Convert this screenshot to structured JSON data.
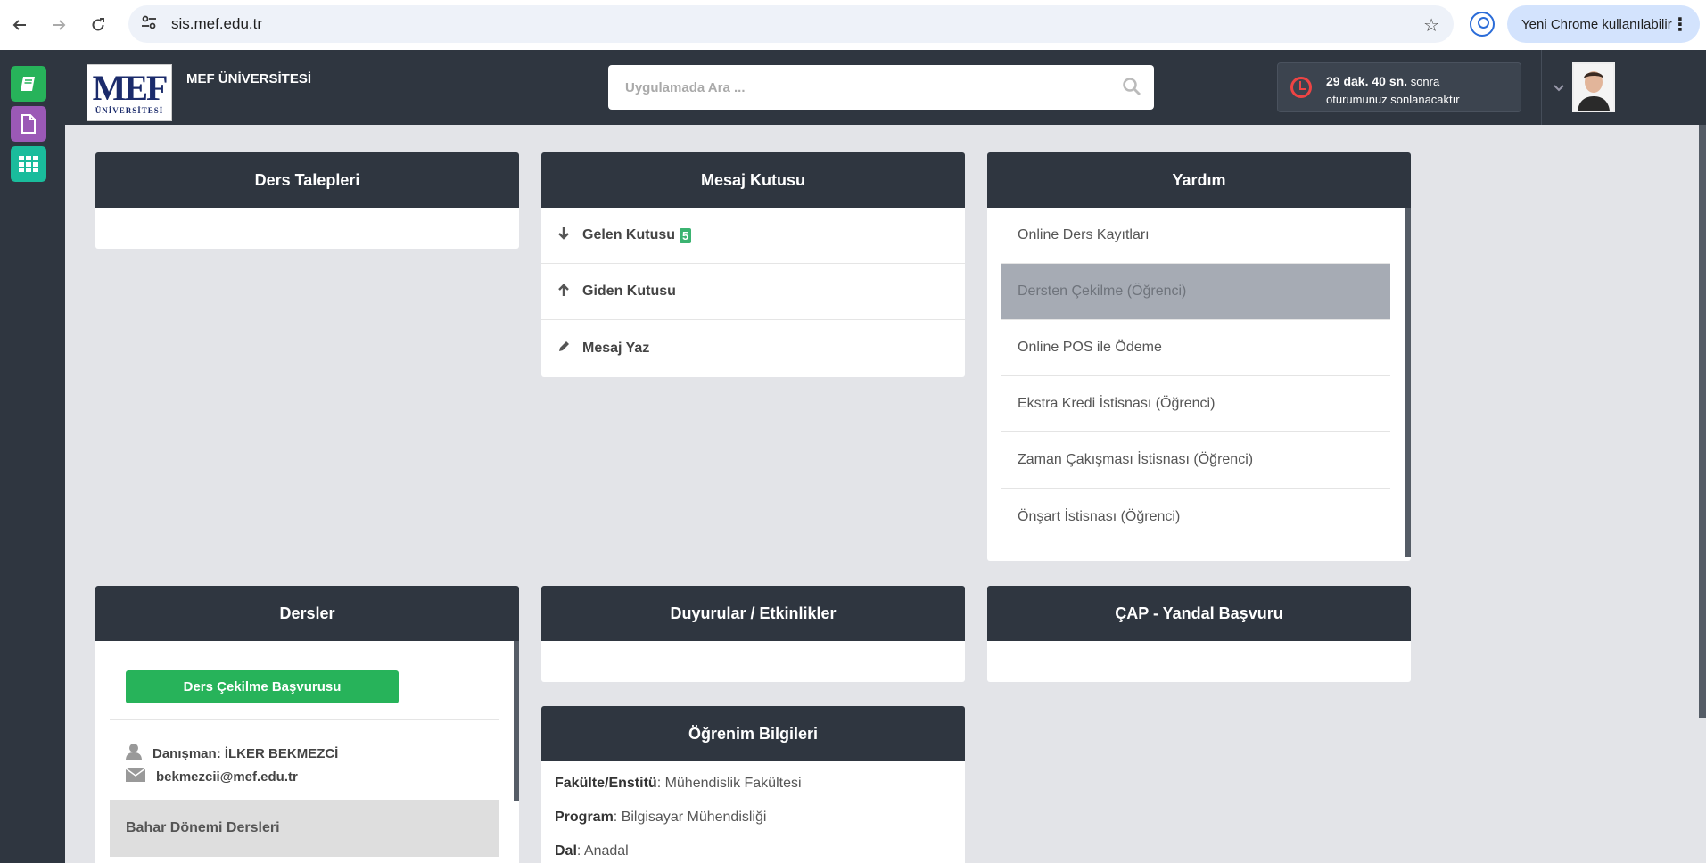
{
  "browser": {
    "url": "sis.mef.edu.tr",
    "update_chip": "Yeni Chrome kullanılabilir"
  },
  "header": {
    "logo_text": "MEF",
    "logo_sub": "ÜNİVERSİTESİ",
    "university_name": "MEF ÜNİVERSİTESİ",
    "search_placeholder": "Uygulamada Ara ...",
    "session_time": "29 dak. 40 sn.",
    "session_suffix": "sonra",
    "session_line2": "oturumunuz sonlanacaktır"
  },
  "panels": {
    "ders_talepleri": {
      "title": "Ders Talepleri"
    },
    "mesaj_kutusu": {
      "title": "Mesaj Kutusu",
      "items": [
        {
          "label": "Gelen Kutusu",
          "badge": "5"
        },
        {
          "label": "Giden Kutusu"
        },
        {
          "label": "Mesaj Yaz"
        }
      ]
    },
    "yardim": {
      "title": "Yardım",
      "items": [
        {
          "label": "Online Ders Kayıtları"
        },
        {
          "label": "Dersten Çekilme (Öğrenci)"
        },
        {
          "label": "Online POS ile Ödeme"
        },
        {
          "label": "Ekstra Kredi İstisnası (Öğrenci)"
        },
        {
          "label": "Zaman Çakışması İstisnası (Öğrenci)"
        },
        {
          "label": "Önşart İstisnası (Öğrenci)"
        }
      ],
      "active_index": 1
    },
    "dersler": {
      "title": "Dersler",
      "button": "Ders Çekilme Başvurusu",
      "advisor_label": "Danışman: İLKER BEKMEZCİ",
      "advisor_email": "bekmezcii@mef.edu.tr",
      "semester": "Bahar Dönemi Dersleri"
    },
    "duyurular": {
      "title": "Duyurular / Etkinlikler"
    },
    "cap": {
      "title": "ÇAP - Yandal Başvuru"
    },
    "ogrenim": {
      "title": "Öğrenim Bilgileri",
      "rows": [
        {
          "label": "Fakülte/Enstitü",
          "value": ": Mühendislik Fakültesi"
        },
        {
          "label": "Program",
          "value": ": Bilgisayar Mühendisliği"
        },
        {
          "label": "Dal",
          "value": ": Anadal"
        }
      ]
    }
  },
  "colors": {
    "dark": "#2f3640",
    "green": "#27b35a",
    "purple": "#9b59b6",
    "teal": "#1abc9c"
  }
}
